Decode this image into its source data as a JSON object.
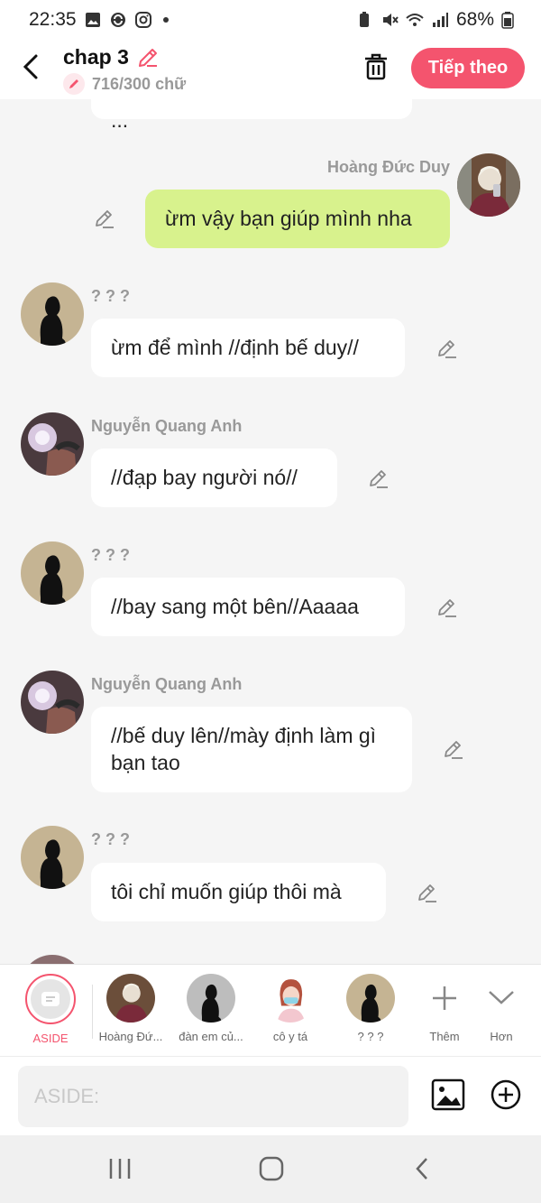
{
  "status": {
    "time": "22:35",
    "battery": "68%",
    "icons_left": [
      "gallery-icon",
      "sync-icon",
      "instagram-icon"
    ],
    "icons_right": [
      "battery-saver-icon",
      "mute-icon",
      "wifi-icon",
      "signal-icon",
      "battery-icon"
    ]
  },
  "header": {
    "title": "chap 3",
    "count": "716/300 chữ",
    "next_label": "Tiếp theo",
    "accent": "#f4546e"
  },
  "chat": {
    "partial_text": "...",
    "messages": [
      {
        "side": "right",
        "name": "Hoàng Đức Duy",
        "text": "ừm vậy bạn giúp mình nha"
      },
      {
        "side": "left",
        "name": "? ? ?",
        "text": "ừm để mình //định bế duy//"
      },
      {
        "side": "left",
        "name": "Nguyễn Quang Anh",
        "text": "//đạp bay người nó//"
      },
      {
        "side": "left",
        "name": "? ? ?",
        "text": "//bay sang một bên//Aaaaa"
      },
      {
        "side": "left",
        "name": "Nguyễn Quang Anh",
        "text": "//bế duy lên//mày định làm gì bạn tao"
      },
      {
        "side": "left",
        "name": "? ? ?",
        "text": "tôi chỉ muốn giúp thôi mà"
      }
    ]
  },
  "characters": [
    {
      "label": "ASIDE"
    },
    {
      "label": "Hoàng Đứ..."
    },
    {
      "label": "đàn em củ..."
    },
    {
      "label": "cô y tá"
    },
    {
      "label": "? ? ?"
    },
    {
      "label": "Thêm"
    },
    {
      "label": "Hơn"
    }
  ],
  "input": {
    "placeholder": "ASIDE:"
  },
  "colors": {
    "accent": "#f4546e",
    "my_bubble": "#d8f28d"
  }
}
